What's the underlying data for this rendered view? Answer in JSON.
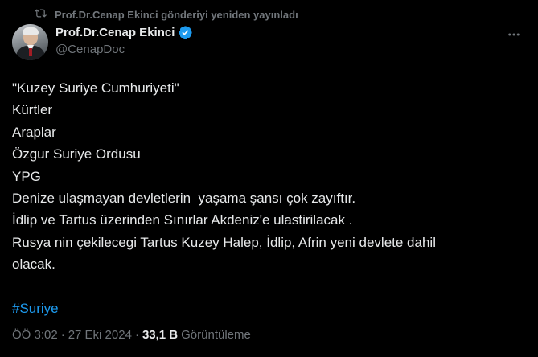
{
  "repost": {
    "icon": "repost-icon",
    "text": "Prof.Dr.Cenap Ekinci gönderiyi yeniden yayınladı"
  },
  "author": {
    "display_name": "Prof.Dr.Cenap Ekinci",
    "handle": "@CenapDoc",
    "verified_icon": "verified-badge-icon",
    "verified_color": "#1d9bf0"
  },
  "menu": {
    "icon": "more-options-icon"
  },
  "tweet": {
    "lines": [
      "\"Kuzey Suriye Cumhuriyeti\"",
      "Kürtler",
      "Araplar",
      "Özgur Suriye Ordusu",
      "YPG",
      "Denize ulaşmayan devletlerin  yaşama şansı çok zayıftır.",
      "İdlip ve Tartus üzerinden Sınırlar Akdeniz'e ulastirilacak .",
      "Rusya nin çekilecegi Tartus Kuzey Halep, İdlip, Afrin yeni devlete dahil",
      "olacak.",
      ""
    ],
    "hashtag": "#Suriye",
    "hashtag_color": "#1d9bf0"
  },
  "meta": {
    "time": "ÖÖ 3:02",
    "separator": "·",
    "date": "27 Eki 2024",
    "views_count": "33,1 B",
    "views_label": "Görüntüleme"
  }
}
